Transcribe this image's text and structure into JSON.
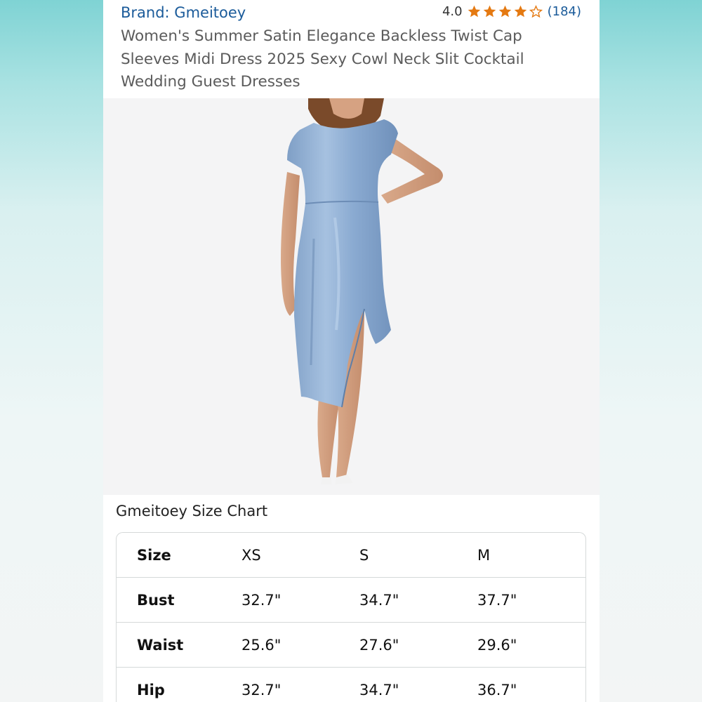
{
  "header": {
    "brand": "Brand: Gmeitoey",
    "rating_value": "4.0",
    "rating_stars": 4,
    "rating_max": 5,
    "rating_count": "(184)",
    "title": "Women's Summer Satin Elegance Backless Twist Cap Sleeves Midi Dress 2025 Sexy Cowl Neck Slit Cocktail Wedding Guest Dresses"
  },
  "colors": {
    "brand_link": "#1b5b9a",
    "star": "#e47911",
    "dress": "#8fb0d6"
  },
  "size_chart": {
    "title": "Gmeitoey Size Chart",
    "rows": [
      [
        "Size",
        "XS",
        "S",
        "M"
      ],
      [
        "Bust",
        "32.7\"",
        "34.7\"",
        "37.7\""
      ],
      [
        "Waist",
        "25.6\"",
        "27.6\"",
        "29.6\""
      ],
      [
        "Hip",
        "32.7\"",
        "34.7\"",
        "36.7\""
      ]
    ]
  }
}
